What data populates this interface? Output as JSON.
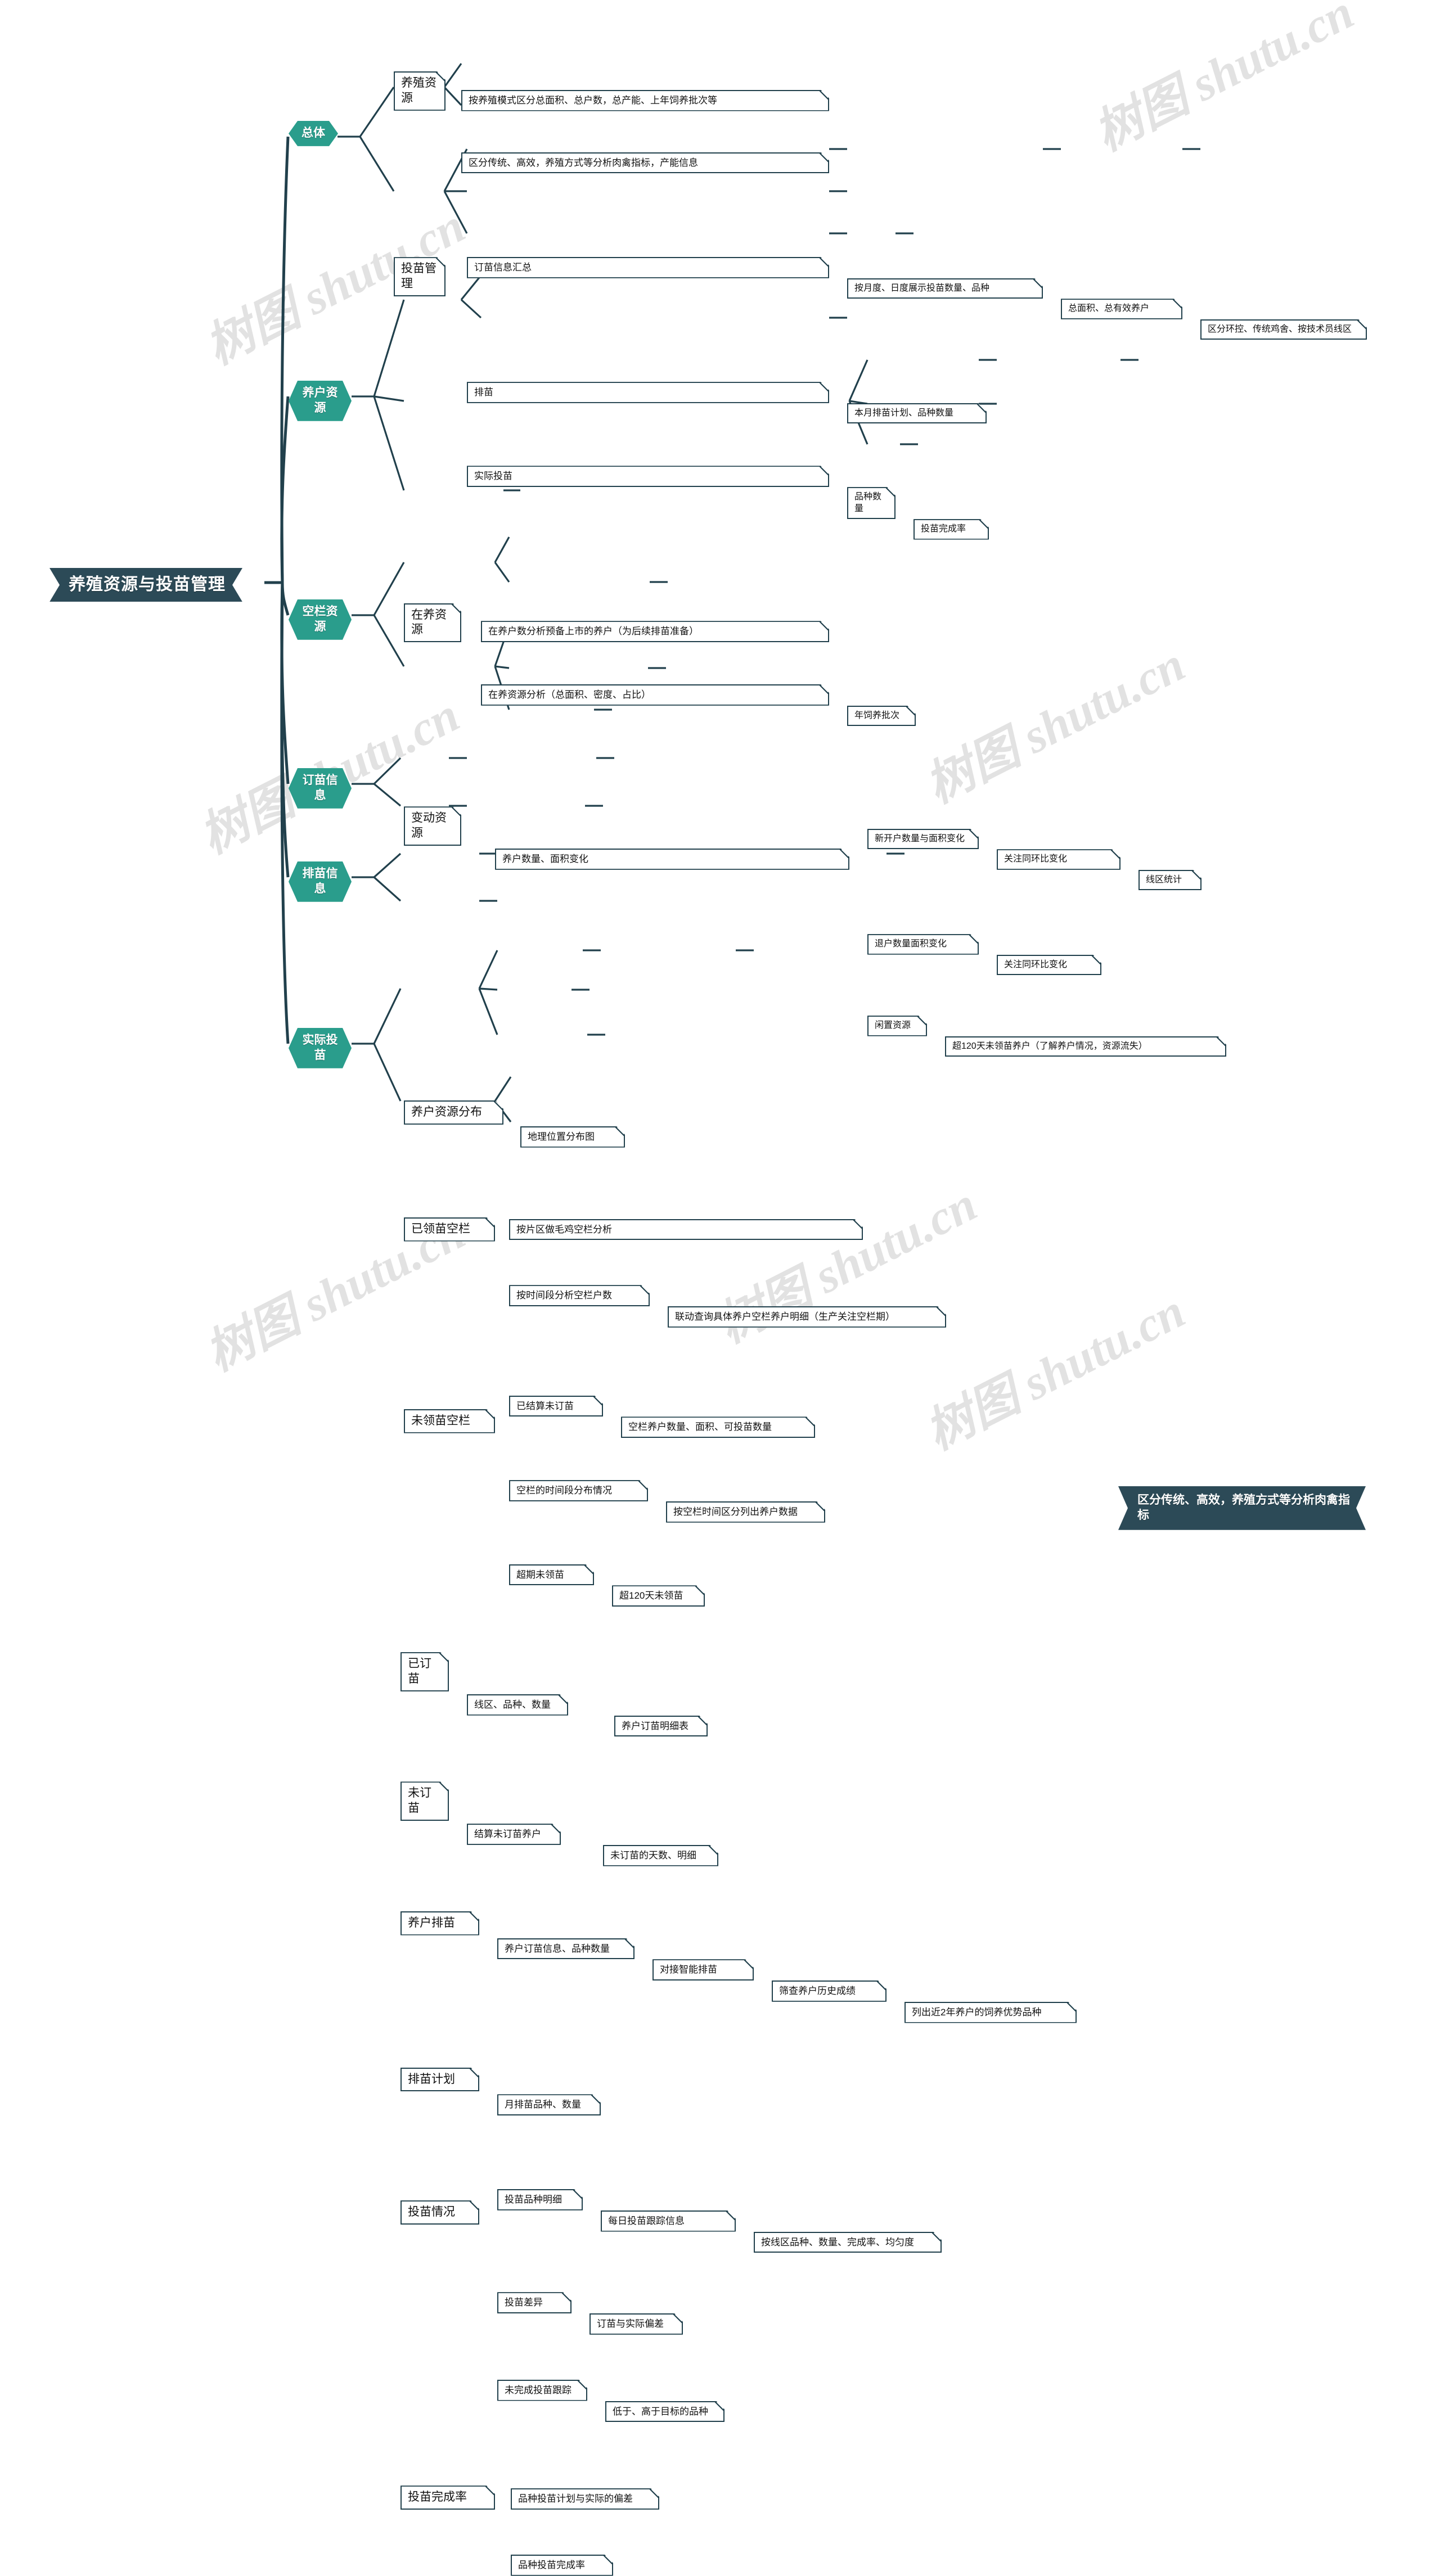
{
  "title": "养殖资源与投苗管理",
  "root": {
    "label": "养殖资源与投苗管理"
  },
  "colors": {
    "root_bg": "#2c4a57",
    "level1_bg": "#2a9d8c",
    "line": "#21404c",
    "box_border": "#21404c",
    "box_bg": "#ffffff",
    "text": "#111111",
    "watermark": "#e2e2e2"
  },
  "watermark": {
    "text": "树图 shutu.cn"
  },
  "callout": {
    "label": "区分传统、高效，养殖方式等分析肉禽指标"
  },
  "branches": [
    {
      "label": "总体",
      "children": [
        {
          "label": "养殖资源",
          "children": [
            {
              "label": "按养殖模式区分总面积、总户数，总产能、上年饲养批次等",
              "children": []
            },
            {
              "label": "区分传统、高效，养殖方式等分析肉禽指标，产能信息",
              "children": []
            }
          ]
        },
        {
          "label": "投苗管理",
          "children": [
            {
              "label": "订苗信息汇总",
              "children": [
                {
                  "label": "按月度、日度展示投苗数量、品种",
                  "children": [
                    {
                      "label": "总面积、总有效养户",
                      "children": [
                        {
                          "label": "区分环控、传统鸡舍、按技术员线区"
                        }
                      ]
                    }
                  ]
                }
              ]
            },
            {
              "label": "排苗",
              "children": [
                {
                  "label": "本月排苗计划、品种数量",
                  "children": []
                }
              ]
            },
            {
              "label": "实际投苗",
              "children": [
                {
                  "label": "品种数量",
                  "children": [
                    {
                      "label": "投苗完成率"
                    }
                  ]
                }
              ]
            }
          ]
        }
      ]
    },
    {
      "label": "养户资源",
      "children": [
        {
          "label": "在养资源",
          "children": [
            {
              "label": "在养户数分析预备上市的养户（为后续排苗准备）",
              "children": []
            },
            {
              "label": "在养资源分析（总面积、密度、占比）",
              "children": [
                {
                  "label": "年饲养批次"
                }
              ]
            }
          ]
        },
        {
          "label": "变动资源",
          "children": [
            {
              "label": "养户数量、面积变化",
              "children": [
                {
                  "label": "新开户数量与面积变化",
                  "children": [
                    {
                      "label": "关注同环比变化",
                      "children": [
                        {
                          "label": "线区统计"
                        }
                      ]
                    }
                  ]
                },
                {
                  "label": "退户数量面积变化",
                  "children": [
                    {
                      "label": "关注同环比变化"
                    }
                  ]
                },
                {
                  "label": "闲置资源",
                  "children": [
                    {
                      "label": "超120天未领苗养户（了解养户情况，资源流失）"
                    }
                  ]
                }
              ]
            }
          ]
        },
        {
          "label": "养户资源分布",
          "children": [
            {
              "label": "地理位置分布图",
              "children": []
            }
          ]
        }
      ]
    },
    {
      "label": "空栏资源",
      "children": [
        {
          "label": "已领苗空栏",
          "children": [
            {
              "label": "按片区做毛鸡空栏分析",
              "children": []
            },
            {
              "label": "按时间段分析空栏户数",
              "children": [
                {
                  "label": "联动查询具体养户空栏养户明细（生产关注空栏期）"
                }
              ]
            }
          ]
        },
        {
          "label": "未领苗空栏",
          "children": [
            {
              "label": "已结算未订苗",
              "children": [
                {
                  "label": "空栏养户数量、面积、可投苗数量"
                }
              ]
            },
            {
              "label": "空栏的时间段分布情况",
              "children": [
                {
                  "label": "按空栏时间区分列出养户数据"
                }
              ]
            },
            {
              "label": "超期未领苗",
              "children": [
                {
                  "label": "超120天未领苗"
                }
              ]
            }
          ]
        }
      ]
    },
    {
      "label": "订苗信息",
      "children": [
        {
          "label": "已订苗",
          "children": [
            {
              "label": "线区、品种、数量",
              "children": [
                {
                  "label": "养户订苗明细表"
                }
              ]
            }
          ]
        },
        {
          "label": "未订苗",
          "children": [
            {
              "label": "结算未订苗养户",
              "children": [
                {
                  "label": "未订苗的天数、明细"
                }
              ]
            }
          ]
        }
      ]
    },
    {
      "label": "排苗信息",
      "children": [
        {
          "label": "养户排苗",
          "children": [
            {
              "label": "养户订苗信息、品种数量",
              "children": [
                {
                  "label": "对接智能排苗",
                  "children": [
                    {
                      "label": "筛查养户历史成绩",
                      "children": [
                        {
                          "label": "列出近2年养户的饲养优势品种"
                        }
                      ]
                    }
                  ]
                }
              ]
            }
          ]
        },
        {
          "label": "排苗计划",
          "children": [
            {
              "label": "月排苗品种、数量",
              "children": []
            }
          ]
        }
      ]
    },
    {
      "label": "实际投苗",
      "children": [
        {
          "label": "投苗情况",
          "children": [
            {
              "label": "投苗品种明细",
              "children": [
                {
                  "label": "每日投苗跟踪信息",
                  "children": [
                    {
                      "label": "按线区品种、数量、完成率、均匀度"
                    }
                  ]
                }
              ]
            },
            {
              "label": "投苗差异",
              "children": [
                {
                  "label": "订苗与实际偏差"
                }
              ]
            },
            {
              "label": "未完成投苗跟踪",
              "children": [
                {
                  "label": "低于、高于目标的品种"
                }
              ]
            }
          ]
        },
        {
          "label": "投苗完成率",
          "children": [
            {
              "label": "品种投苗计划与实际的偏差",
              "children": []
            },
            {
              "label": "品种投苗完成率",
              "children": []
            }
          ]
        }
      ]
    }
  ],
  "nodes": {
    "root": "养殖资源与投苗管理",
    "b1": "总体",
    "b1_1": "养殖资源",
    "b1_1_1": "按养殖模式区分总面积、总户数，总产能、上年饲养批次等",
    "b1_1_2": "区分传统、高效，养殖方式等分析肉禽指标，产能信息",
    "b1_2": "投苗管理",
    "b1_2_1": "订苗信息汇总",
    "b1_2_1_1": "按月度、日度展示投苗数量、品种",
    "b1_2_1_1_1": "总面积、总有效养户",
    "b1_2_1_1_1_1": "区分环控、传统鸡舍、按技术员线区",
    "b1_2_2": "排苗",
    "b1_2_2_1": "本月排苗计划、品种数量",
    "b1_2_3": "实际投苗",
    "b1_2_3_1": "品种数量",
    "b1_2_3_1_1": "投苗完成率",
    "b2": "养户资源",
    "b2_1": "在养资源",
    "b2_1_1": "在养户数分析预备上市的养户（为后续排苗准备）",
    "b2_1_2": "在养资源分析（总面积、密度、占比）",
    "b2_1_2_1": "年饲养批次",
    "b2_2": "变动资源",
    "b2_2_1": "养户数量、面积变化",
    "b2_2_1_1": "新开户数量与面积变化",
    "b2_2_1_1_1": "关注同环比变化",
    "b2_2_1_1_1_1": "线区统计",
    "b2_2_1_2": "退户数量面积变化",
    "b2_2_1_2_1": "关注同环比变化",
    "b2_2_1_3": "闲置资源",
    "b2_2_1_3_1": "超120天未领苗养户（了解养户情况，资源流失）",
    "b2_3": "养户资源分布",
    "b2_3_1": "地理位置分布图",
    "b3": "空栏资源",
    "b3_1": "已领苗空栏",
    "b3_1_1": "按片区做毛鸡空栏分析",
    "b3_1_2": "按时间段分析空栏户数",
    "b3_1_2_1": "联动查询具体养户空栏养户明细（生产关注空栏期）",
    "b3_2": "未领苗空栏",
    "b3_2_1": "已结算未订苗",
    "b3_2_1_1": "空栏养户数量、面积、可投苗数量",
    "b3_2_2": "空栏的时间段分布情况",
    "b3_2_2_1": "按空栏时间区分列出养户数据",
    "b3_2_3": "超期未领苗",
    "b3_2_3_1": "超120天未领苗",
    "b4": "订苗信息",
    "b4_1": "已订苗",
    "b4_1_1": "线区、品种、数量",
    "b4_1_1_1": "养户订苗明细表",
    "b4_2": "未订苗",
    "b4_2_1": "结算未订苗养户",
    "b4_2_1_1": "未订苗的天数、明细",
    "b5": "排苗信息",
    "b5_1": "养户排苗",
    "b5_1_1": "养户订苗信息、品种数量",
    "b5_1_1_1": "对接智能排苗",
    "b5_1_1_1_1": "筛查养户历史成绩",
    "b5_1_1_1_1_1": "列出近2年养户的饲养优势品种",
    "b5_2": "排苗计划",
    "b5_2_1": "月排苗品种、数量",
    "b6": "实际投苗",
    "b6_1": "投苗情况",
    "b6_1_1": "投苗品种明细",
    "b6_1_1_1": "每日投苗跟踪信息",
    "b6_1_1_1_1": "按线区品种、数量、完成率、均匀度",
    "b6_1_2": "投苗差异",
    "b6_1_2_1": "订苗与实际偏差",
    "b6_1_3": "未完成投苗跟踪",
    "b6_1_3_1": "低于、高于目标的品种",
    "b6_2": "投苗完成率",
    "b6_2_1": "品种投苗计划与实际的偏差",
    "b6_2_2": "品种投苗完成率",
    "callout": "区分传统、高效，养殖方式等分析肉禽指标"
  }
}
